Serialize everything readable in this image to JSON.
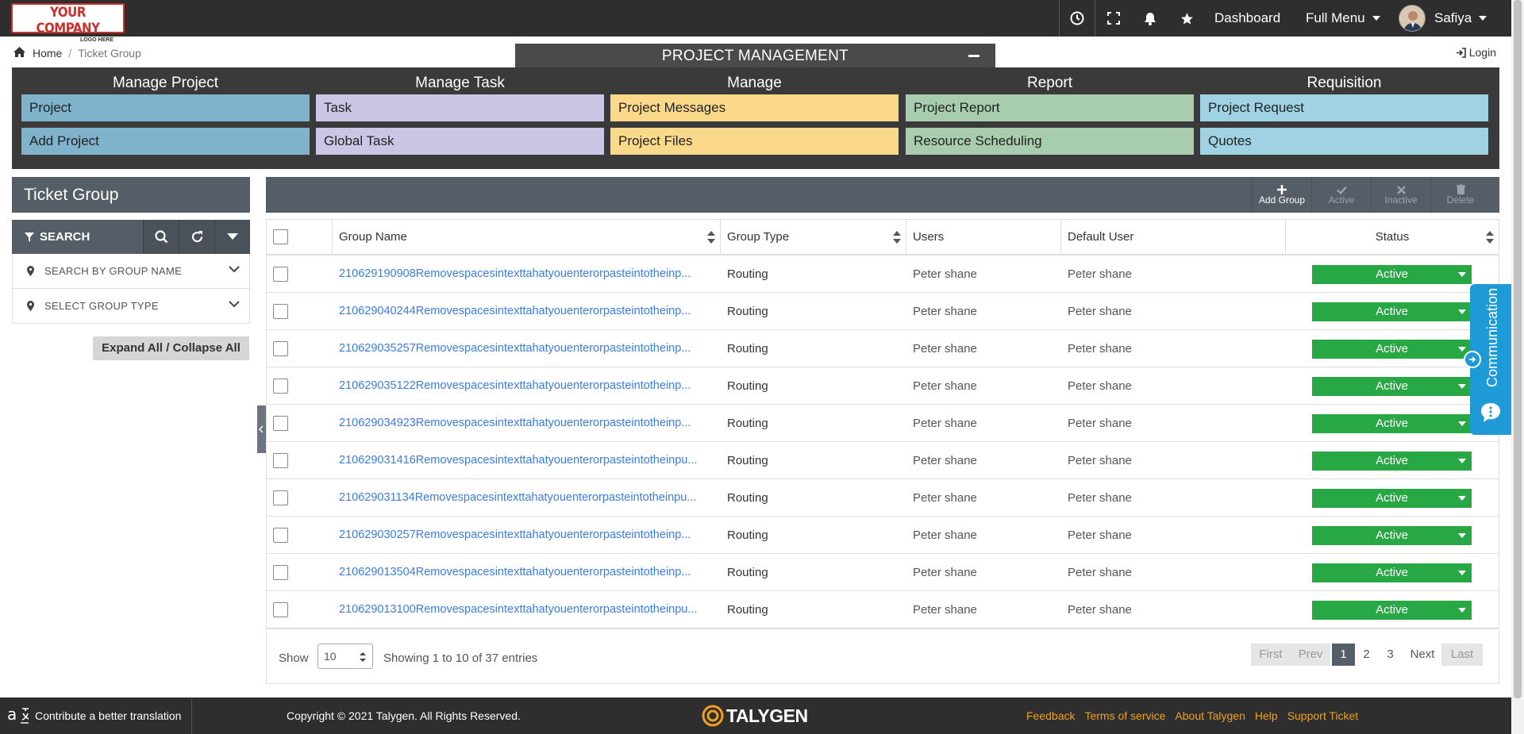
{
  "logo": {
    "line1": "YOUR COMPANY",
    "line2": "LOGO HERE"
  },
  "topnav": {
    "dashboard": "Dashboard",
    "full_menu": "Full Menu",
    "user": "Safiya"
  },
  "breadcrumb": {
    "home": "Home",
    "current": "Ticket Group"
  },
  "login": "Login",
  "pm": {
    "title": "PROJECT MANAGEMENT",
    "columns": [
      {
        "header": "Manage Project",
        "color": "#7fb3cc",
        "items": [
          "Project",
          "Add Project"
        ]
      },
      {
        "header": "Manage Task",
        "color": "#ccc6e6",
        "items": [
          "Task",
          "Global Task"
        ]
      },
      {
        "header": "Manage",
        "color": "#fbd98a",
        "items": [
          "Project Messages",
          "Project Files"
        ]
      },
      {
        "header": "Report",
        "color": "#a8ccae",
        "items": [
          "Project Report",
          "Resource Scheduling"
        ]
      },
      {
        "header": "Requisition",
        "color": "#9fd3e3",
        "items": [
          "Project Request",
          "Quotes"
        ]
      }
    ]
  },
  "panel": {
    "title": "Ticket Group",
    "search_label": "SEARCH",
    "filter_group_name": "SEARCH BY GROUP NAME",
    "filter_group_type": "SELECT GROUP TYPE",
    "expand_collapse": "Expand All / Collapse All"
  },
  "toolbar": {
    "add_group": "Add Group",
    "active": "Active",
    "inactive": "Inactive",
    "delete": "Delete"
  },
  "table": {
    "headers": {
      "group_name": "Group Name",
      "group_type": "Group Type",
      "users": "Users",
      "default_user": "Default User",
      "status": "Status"
    },
    "rows": [
      {
        "name": "210629190908Removespacesintexttahatyouenterorpasteintotheinp...",
        "type": "Routing",
        "users": "Peter shane",
        "default_user": "Peter shane",
        "status": "Active"
      },
      {
        "name": "210629040244Removespacesintexttahatyouenterorpasteintotheinp...",
        "type": "Routing",
        "users": "Peter shane",
        "default_user": "Peter shane",
        "status": "Active"
      },
      {
        "name": "210629035257Removespacesintexttahatyouenterorpasteintotheinp...",
        "type": "Routing",
        "users": "Peter shane",
        "default_user": "Peter shane",
        "status": "Active"
      },
      {
        "name": "210629035122Removespacesintexttahatyouenterorpasteintotheinp...",
        "type": "Routing",
        "users": "Peter shane",
        "default_user": "Peter shane",
        "status": "Active"
      },
      {
        "name": "210629034923Removespacesintexttahatyouenterorpasteintotheinp...",
        "type": "Routing",
        "users": "Peter shane",
        "default_user": "Peter shane",
        "status": "Active"
      },
      {
        "name": "210629031416Removespacesintexttahatyouenterorpasteintotheinpu...",
        "type": "Routing",
        "users": "Peter shane",
        "default_user": "Peter shane",
        "status": "Active"
      },
      {
        "name": "210629031134Removespacesintexttahatyouenterorpasteintotheinpu...",
        "type": "Routing",
        "users": "Peter shane",
        "default_user": "Peter shane",
        "status": "Active"
      },
      {
        "name": "210629030257Removespacesintexttahatyouenterorpasteintotheinp...",
        "type": "Routing",
        "users": "Peter shane",
        "default_user": "Peter shane",
        "status": "Active"
      },
      {
        "name": "210629013504Removespacesintexttahatyouenterorpasteintotheinp...",
        "type": "Routing",
        "users": "Peter shane",
        "default_user": "Peter shane",
        "status": "Active"
      },
      {
        "name": "210629013100Removespacesintexttahatyouenterorpasteintotheinpu...",
        "type": "Routing",
        "users": "Peter shane",
        "default_user": "Peter shane",
        "status": "Active"
      }
    ]
  },
  "pager": {
    "show_label": "Show",
    "page_size": "10",
    "info": "Showing 1 to 10 of 37 entries",
    "first": "First",
    "prev": "Prev",
    "pages": [
      "1",
      "2",
      "3"
    ],
    "next": "Next",
    "last": "Last"
  },
  "communication": "Communication",
  "footer": {
    "translate": "Contribute a better translation",
    "copyright": "Copyright © 2021 Talygen. All Rights Reserved.",
    "brand": "TALYGEN",
    "links": [
      "Feedback",
      "Terms of service",
      "About Talygen",
      "Help",
      "Support Ticket"
    ]
  }
}
